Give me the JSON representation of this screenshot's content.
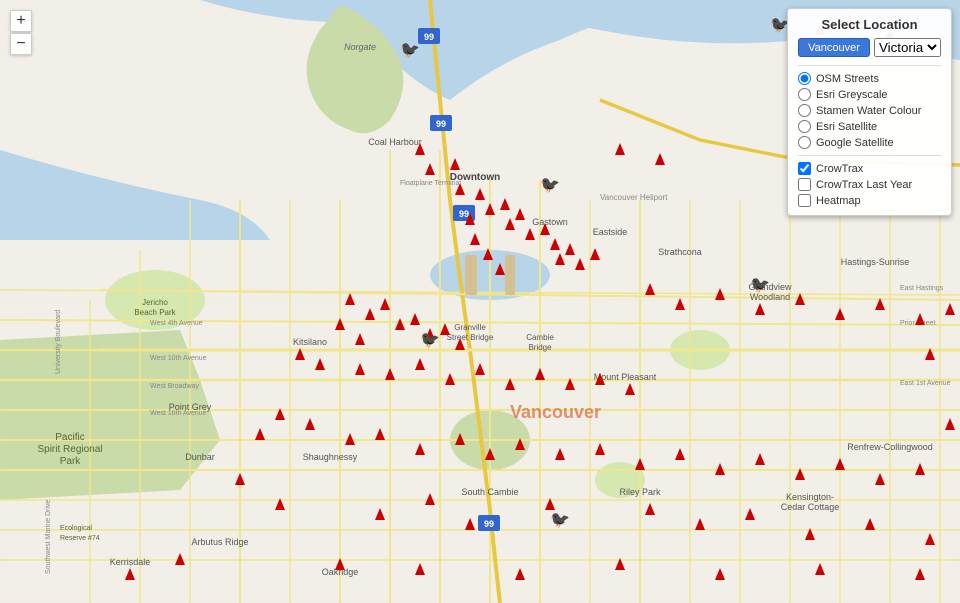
{
  "panel": {
    "title": "Select Location",
    "locations": [
      {
        "label": "Vancouver",
        "active": true
      },
      {
        "label": "Victoria",
        "active": false
      }
    ],
    "tileLayers": [
      {
        "label": "OSM Streets",
        "value": "osm",
        "selected": true
      },
      {
        "label": "Esri Greyscale",
        "value": "esri_grey",
        "selected": false
      },
      {
        "label": "Stamen Water Colour",
        "value": "stamen_water",
        "selected": false
      },
      {
        "label": "Esri Satellite",
        "value": "esri_sat",
        "selected": false
      },
      {
        "label": "Google Satellite",
        "value": "google_sat",
        "selected": false
      }
    ],
    "overlays": [
      {
        "label": "CrowTrax",
        "value": "crowtrax",
        "checked": true
      },
      {
        "label": "CrowTrax Last Year",
        "value": "crowtrax_last",
        "checked": false
      },
      {
        "label": "Heatmap",
        "value": "heatmap",
        "checked": false
      }
    ]
  },
  "zoom": {
    "in_label": "+",
    "out_label": "−"
  },
  "map": {
    "center": "Vancouver, BC",
    "neighborhoods": [
      "Norgate",
      "Coal Harbour",
      "Downtown",
      "Gastown",
      "Eastside",
      "Strathcona",
      "Grandview Woodland",
      "Hastings-Sunrise",
      "Jericho Beach Park",
      "Kitsilano",
      "Granville Street Bridge",
      "Cambie Bridge",
      "Mount Pleasant",
      "Kensington-Cedar Cottage",
      "Renfrew-Collingwood",
      "Pacific Spirit Regional Park",
      "Point Grey",
      "Dunbar",
      "Shaughnessy",
      "South Cambie",
      "Riley Park",
      "Arbutus Ridge",
      "Kerrisdale",
      "Oakridge"
    ]
  }
}
